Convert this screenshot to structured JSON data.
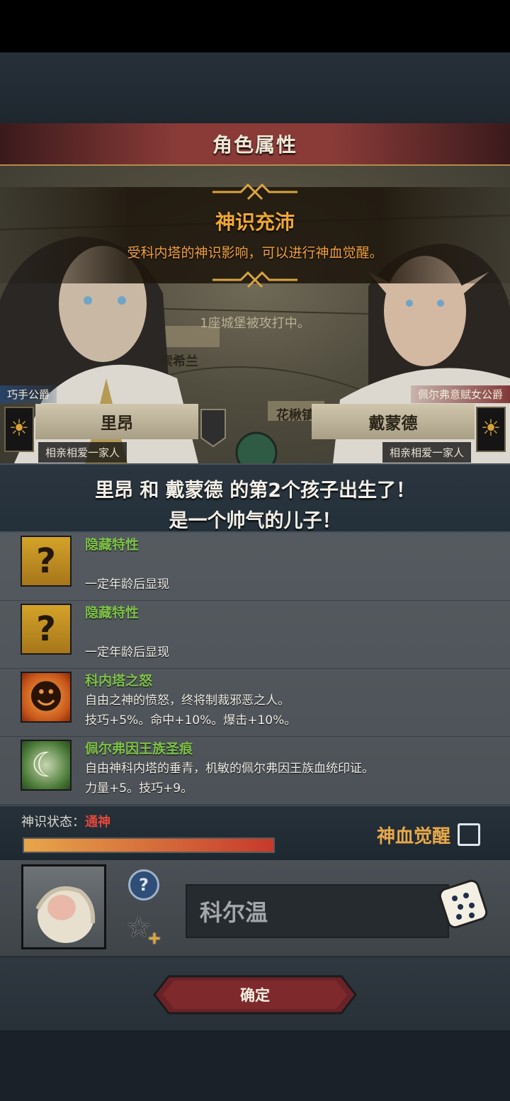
{
  "header": {
    "title": "角色属性"
  },
  "event": {
    "title": "神识充沛",
    "description": "受科内塔的神识影响，可以进行神血觉醒。",
    "map_news": "1座城堡被攻打中。",
    "map_labels": [
      "索希兰",
      "花楸镇"
    ]
  },
  "parents": [
    {
      "title": "巧手公爵",
      "name": "里昂",
      "relation": "相亲相爱一家人"
    },
    {
      "title": "佩尔弗意赋女公爵",
      "name": "戴蒙德",
      "relation": "相亲相爱一家人"
    }
  ],
  "birth": {
    "line1": "里昂 和 戴蒙德 的第2个孩子出生了！",
    "line2": "是一个帅气的儿子！"
  },
  "traits": [
    {
      "icon": "question-mark-icon",
      "name": "隐藏特性",
      "line1": "",
      "line2": "一定年龄后显现"
    },
    {
      "icon": "question-mark-icon",
      "name": "隐藏特性",
      "line1": "",
      "line2": "一定年龄后显现"
    },
    {
      "icon": "smiling-sun-icon",
      "name": "科内塔之怒",
      "line1": "自由之神的愤怒，终将制裁邪恶之人。",
      "line2": "技巧+5%。命中+10%。爆击+10%。"
    },
    {
      "icon": "wave-crescent-icon",
      "name": "佩尔弗因王族圣痕",
      "line1": "自由神科内塔的垂青，机敏的佩尔弗因王族血统印证。",
      "line2": "力量+5。技巧+9。"
    }
  ],
  "divine": {
    "label": "神识状态：",
    "value": "通神",
    "progress": 1.0,
    "awaken_label": "神血觉醒",
    "awaken_checked": false
  },
  "child": {
    "name": "科尔温",
    "help_glyph": "?",
    "star_glyph": "☆",
    "plus_glyph": "+"
  },
  "confirm_label": "确定",
  "colors": {
    "title_bar": "#8a3b38",
    "event_text": "#f0a832",
    "trait_name": "#7fc24a",
    "divine_value": "#e4473c",
    "awaken": "#e8a84a"
  }
}
